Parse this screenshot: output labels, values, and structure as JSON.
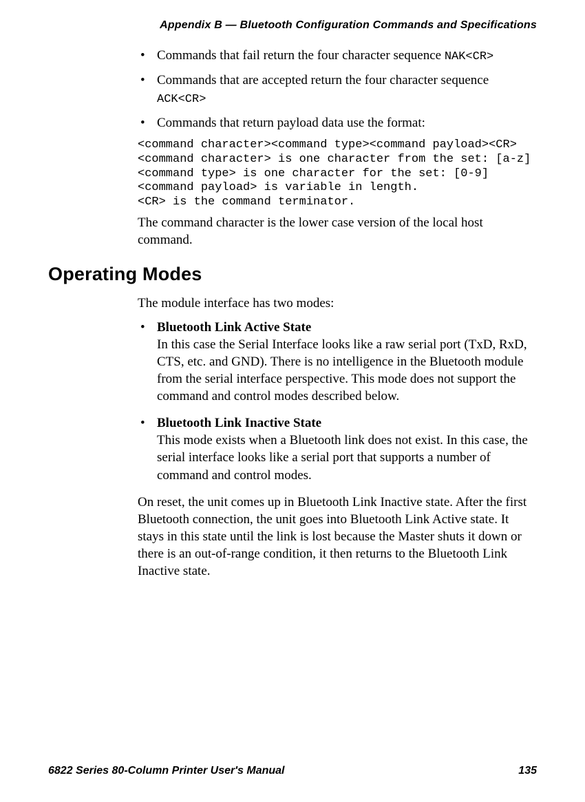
{
  "header": {
    "running_head": "Appendix B — Bluetooth Configuration Commands and Specifications"
  },
  "bullets_top": {
    "item1_pre": "Commands that fail return the four character sequence ",
    "item1_code": "NAK<CR>",
    "item2_pre": "Commands that are accepted return the four character sequence ",
    "item2_code": "ACK<CR>",
    "item3": "Commands that return payload data use the format:"
  },
  "codeblock": "<command character><command type><command payload><CR>\n<command character> is one character from the set: [a-z]\n<command type> is one character for the set: [0-9]\n<command payload> is variable in length.\n<CR> is the command terminator.",
  "para_after_code": "The command character is the lower case version of the local host command.",
  "section_title": "Operating Modes",
  "modes_intro": "The module interface has two modes:",
  "mode1_title": "Bluetooth Link Active State",
  "mode1_body": "In this case the Serial Interface looks like a raw serial port (TxD, RxD, CTS, etc. and GND). There is no intelligence in the Bluetooth module from the serial interface perspective. This mode does not support the command and control modes described below.",
  "mode2_title": "Bluetooth Link Inactive State",
  "mode2_body": "This mode exists when a Bluetooth link does not exist. In this case, the serial interface looks like a serial port that supports a number of command and control modes.",
  "closing_para": "On reset, the unit comes up in Bluetooth Link Inactive state. After the first Bluetooth connection, the unit goes into Bluetooth Link Active state. It stays in this state until the link is lost because the Master shuts it down or there is an out-of-range condition, it then returns to the Bluetooth Link Inactive state.",
  "footer": {
    "left": "6822 Series 80-Column Printer User's Manual",
    "right": "135"
  }
}
